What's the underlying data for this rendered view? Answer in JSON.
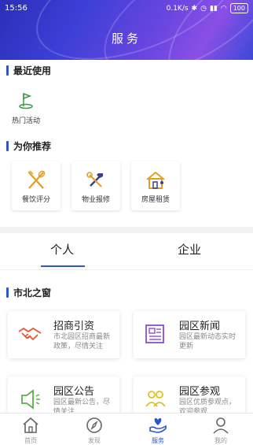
{
  "status_bar": {
    "time": "15:56",
    "speed": "0.1K/s",
    "battery": "100"
  },
  "header": {
    "title": "服务"
  },
  "recent": {
    "title": "最近使用",
    "items": [
      {
        "label": "热门活动",
        "icon": "golf-flag-icon"
      }
    ]
  },
  "recommend": {
    "title": "为你推荐",
    "items": [
      {
        "label": "餐饮评分",
        "icon": "fork-knife-icon"
      },
      {
        "label": "物业报修",
        "icon": "repair-tools-icon"
      },
      {
        "label": "房屋租赁",
        "icon": "house-rent-icon"
      }
    ]
  },
  "tabs": [
    {
      "label": "个人"
    },
    {
      "label": "企业"
    }
  ],
  "window": {
    "title": "市北之窗",
    "cards": [
      {
        "title": "招商引资",
        "desc": "市北园区招商最新政策，尽情关注",
        "icon": "handshake-icon"
      },
      {
        "title": "园区新闻",
        "desc": "园区最新动态实时更新",
        "icon": "newspaper-icon"
      },
      {
        "title": "园区公告",
        "desc": "园区最新公告，尽情关注",
        "icon": "megaphone-icon"
      },
      {
        "title": "园区参观",
        "desc": "园区优质参观点，欢迎参观",
        "icon": "visitors-icon"
      }
    ]
  },
  "tabbar": [
    {
      "label": "首页",
      "icon": "home-icon"
    },
    {
      "label": "发现",
      "icon": "compass-icon"
    },
    {
      "label": "服务",
      "icon": "service-hand-heart-icon",
      "active": true
    },
    {
      "label": "我的",
      "icon": "user-icon"
    }
  ],
  "colors": {
    "accent": "#2e57c9",
    "header_from": "#2a2fb8",
    "header_to": "#8a4fe6"
  }
}
